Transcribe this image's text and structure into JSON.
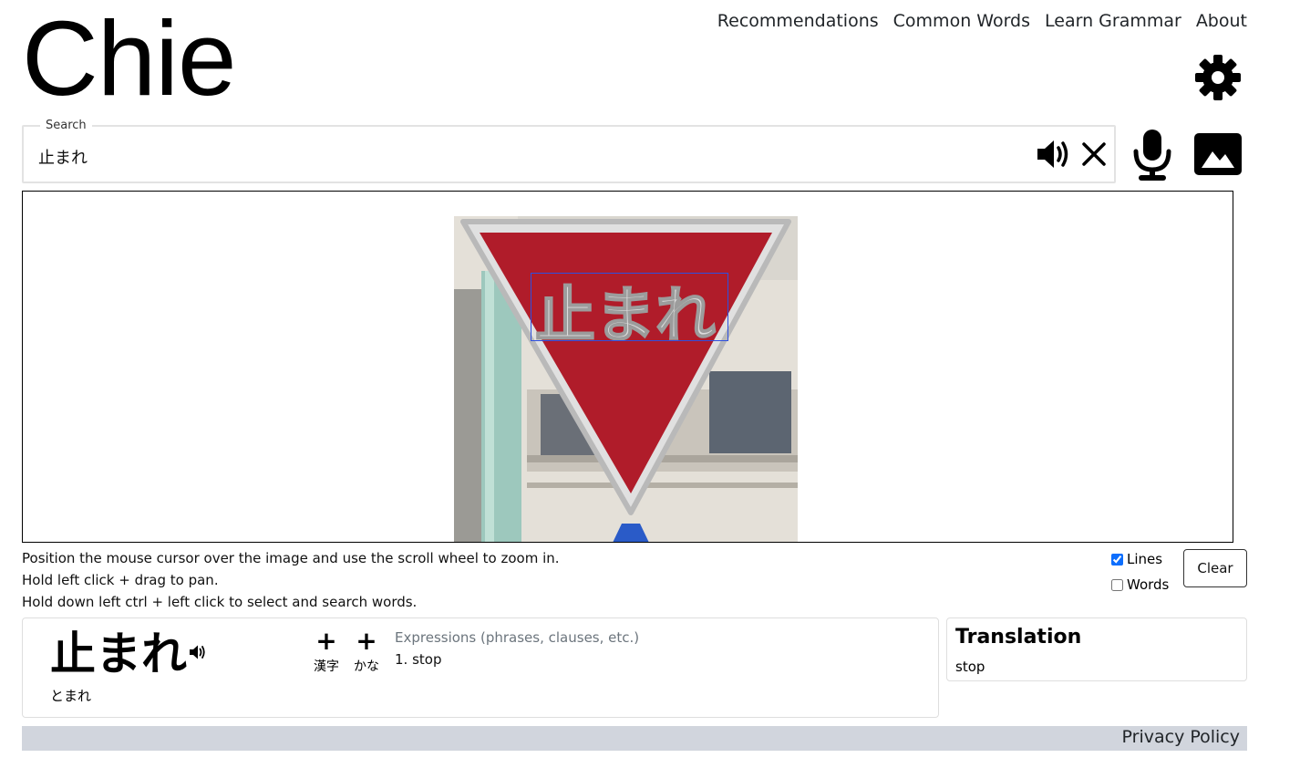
{
  "app": {
    "logo": "Chie"
  },
  "nav": [
    "Recommendations",
    "Common Words",
    "Learn Grammar",
    "About"
  ],
  "search": {
    "legend": "Search",
    "value": "止まれ"
  },
  "hints": [
    "Position the mouse cursor over the image and use the scroll wheel to zoom in.",
    "Hold left click + drag to pan.",
    "Hold down left ctrl + left click to select and search words."
  ],
  "options": {
    "lines_label": "Lines",
    "lines_checked": true,
    "words_label": "Words",
    "words_checked": false,
    "clear_label": "Clear"
  },
  "result": {
    "word": "止まれ",
    "reading": "とまれ",
    "add_kanji_label": "漢字",
    "add_kana_label": "かな",
    "part_of_speech": "Expressions (phrases, clauses, etc.)",
    "definitions": [
      "1. stop"
    ]
  },
  "translation": {
    "title": "Translation",
    "text": "stop"
  },
  "footer": {
    "privacy": "Privacy Policy"
  },
  "colors": {
    "ocr_box": "#2d4fe0",
    "sign_red": "#b01c2a",
    "footer_bg": "#d1d5dd"
  }
}
